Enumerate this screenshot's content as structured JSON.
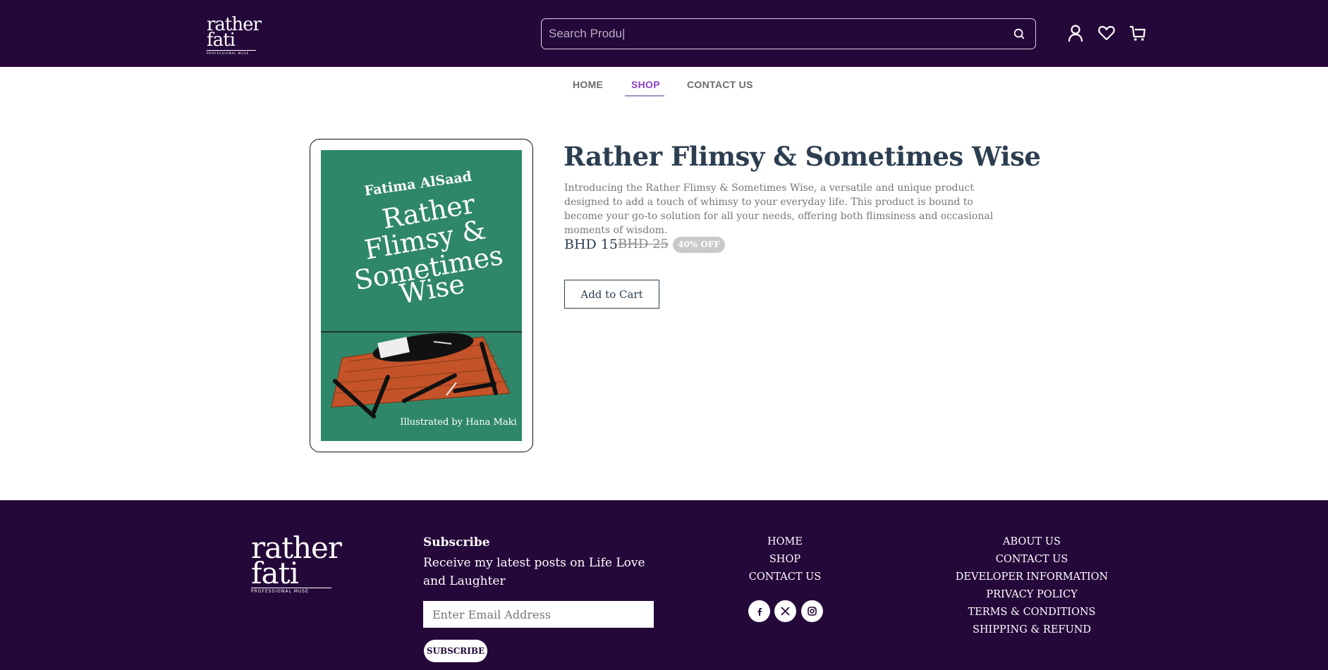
{
  "brand": {
    "name_line1": "rather",
    "name_line2": "fati",
    "tagline": "PROFESSIONAL MUSE"
  },
  "header": {
    "search_placeholder": "Search Produ|",
    "icons": [
      "search-icon",
      "user-icon",
      "heart-icon",
      "cart-icon"
    ]
  },
  "nav": {
    "items": [
      {
        "label": "HOME",
        "active": false
      },
      {
        "label": "SHOP",
        "active": true
      },
      {
        "label": "CONTACT US",
        "active": false
      }
    ]
  },
  "product": {
    "cover": {
      "author": "Fatima AlSaad",
      "title_lines": [
        "Rather",
        "Flimsy &",
        "Sometimes",
        "Wise"
      ],
      "illustrator": "Illustrated by Hana Maki"
    },
    "title": "Rather Flimsy & Sometimes Wise",
    "description": "Introducing the Rather Flimsy & Sometimes Wise, a versatile and unique product designed to add a touch of whimsy to your everyday life. This product is bound to become your go-to solution for all your needs, offering both flimsiness and occasional moments of wisdom.",
    "price": "BHD 15",
    "old_price": "BHD 25",
    "discount": "40% OFF",
    "add_to_cart": "Add to Cart"
  },
  "footer": {
    "subscribe_title": "Subscribe",
    "subscribe_text": "Receive my latest posts on Life Love and Laughter",
    "email_placeholder": "Enter Email Address",
    "subscribe_button": "SUBSCRIBE",
    "links_col1": [
      "HOME",
      "SHOP",
      "CONTACT US"
    ],
    "links_col2": [
      "ABOUT US",
      "CONTACT US",
      "DEVELOPER INFORMATION",
      "PRIVACY POLICY",
      "TERMS & CONDITIONS",
      "SHIPPING & REFUND"
    ],
    "social_icons": [
      "facebook-icon",
      "x-icon",
      "instagram-icon"
    ]
  },
  "colors": {
    "brand_purple": "#25083a",
    "nav_active": "#8a3fc2",
    "cover_green": "#2f876a"
  }
}
